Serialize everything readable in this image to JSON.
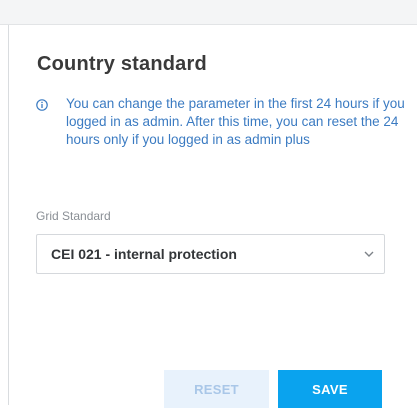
{
  "dialog": {
    "title": "Country standard",
    "info_icon": "info-circle-icon",
    "info_text": "You can change the parameter in the first 24 hours if you logged in as admin. After this time, you can reset the 24 hours only if you logged in as admin plus"
  },
  "grid_standard": {
    "label": "Grid Standard",
    "selected_value": "CEI 021 - internal protection",
    "chevron_icon": "chevron-down-icon"
  },
  "buttons": {
    "reset_label": "RESET",
    "save_label": "SAVE"
  },
  "colors": {
    "accent": "#0aa3ee",
    "info_text": "#3b7bc2",
    "disabled_button_bg": "#e8f2fc",
    "disabled_button_text": "#a9c7e8"
  }
}
